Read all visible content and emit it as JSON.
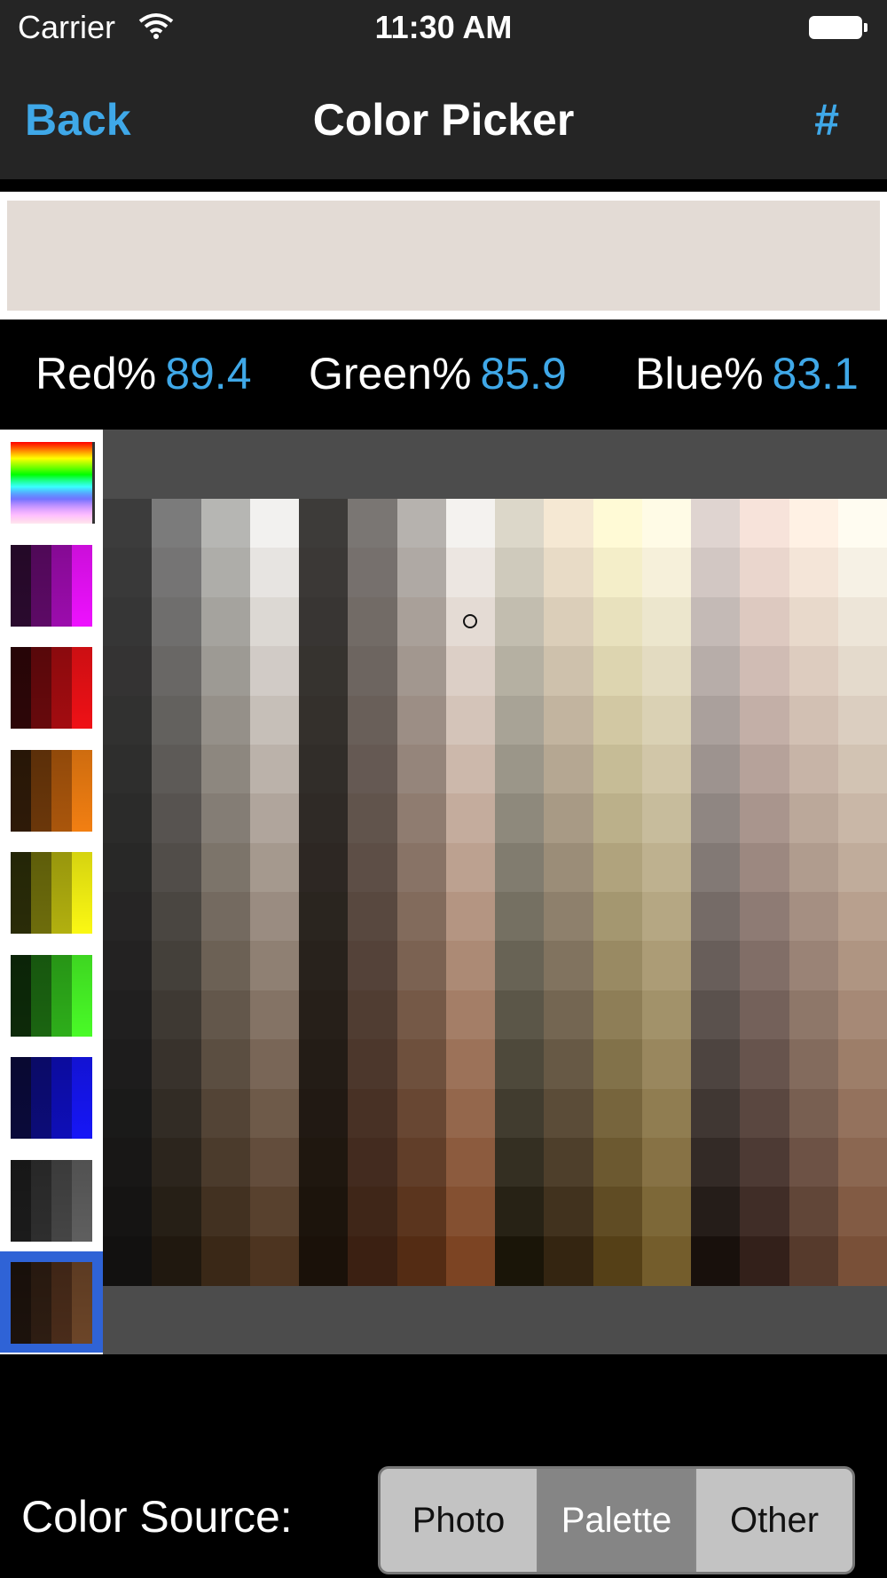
{
  "status_bar": {
    "carrier": "Carrier",
    "time": "11:30 AM"
  },
  "nav": {
    "back_label": "Back",
    "title": "Color Picker",
    "hex_label": "#"
  },
  "current_color": "#e3dbd5",
  "readouts": [
    {
      "label": "Red%",
      "value": "89.4"
    },
    {
      "label": "Green%",
      "value": "85.9"
    },
    {
      "label": "Blue%",
      "value": "83.1"
    }
  ],
  "palette_thumbnails": [
    {
      "name": "spectrum",
      "colors": []
    },
    {
      "name": "magenta",
      "colors": [
        "#2a0a2e",
        "#5d0a66",
        "#9c0cad",
        "#ee11ff"
      ]
    },
    {
      "name": "red",
      "colors": [
        "#2d0608",
        "#67090c",
        "#a30c10",
        "#ef1116"
      ]
    },
    {
      "name": "orange",
      "colors": [
        "#2e1a08",
        "#6b370a",
        "#aa560c",
        "#f27f12"
      ]
    },
    {
      "name": "yellow",
      "colors": [
        "#2a2c08",
        "#6e6d0c",
        "#b2b00f",
        "#fbf813"
      ]
    },
    {
      "name": "green",
      "colors": [
        "#0d2a09",
        "#1b6511",
        "#2eae1a",
        "#49fb27"
      ]
    },
    {
      "name": "blue",
      "colors": [
        "#0a0a3a",
        "#0c0c78",
        "#0e0eb8",
        "#1616f7"
      ]
    },
    {
      "name": "gray",
      "colors": [
        "#1b1b1b",
        "#2e2e2e",
        "#454545",
        "#5f5f5f"
      ]
    },
    {
      "name": "brown",
      "colors": [
        "#1c120c",
        "#2e1d12",
        "#4a2c1a",
        "#6c4528"
      ],
      "selected": true
    }
  ],
  "palette_grid": {
    "columns": [
      {
        "top": "#3c3c3c",
        "bottom": "#121110"
      },
      {
        "top": "#7b7b7b",
        "bottom": "#20180f"
      },
      {
        "top": "#b6b6b3",
        "bottom": "#3a2817"
      },
      {
        "top": "#f2f1ef",
        "bottom": "#4d3420"
      },
      {
        "top": "#3d3b39",
        "bottom": "#1a1109"
      },
      {
        "top": "#7a7673",
        "bottom": "#3b2012"
      },
      {
        "top": "#b6b2ae",
        "bottom": "#542c14"
      },
      {
        "top": "#f4f2ef",
        "bottom": "#7c4423"
      },
      {
        "top": "#dcd7c9",
        "bottom": "#1a1508"
      },
      {
        "top": "#f5e8d3",
        "bottom": "#342511"
      },
      {
        "top": "#fffad6",
        "bottom": "#554017"
      },
      {
        "top": "#fffbe6",
        "bottom": "#745d2c"
      },
      {
        "top": "#dfd4d0",
        "bottom": "#18100c"
      },
      {
        "top": "#f7e3da",
        "bottom": "#33201a"
      },
      {
        "top": "#fff1e4",
        "bottom": "#563a2c"
      },
      {
        "top": "#fffcf1",
        "bottom": "#795038"
      }
    ],
    "rows": 16,
    "marker_col": 7,
    "marker_row": 2
  },
  "color_source": {
    "label": "Color Source:",
    "options": [
      "Photo",
      "Palette",
      "Other"
    ],
    "selected": "Palette"
  }
}
